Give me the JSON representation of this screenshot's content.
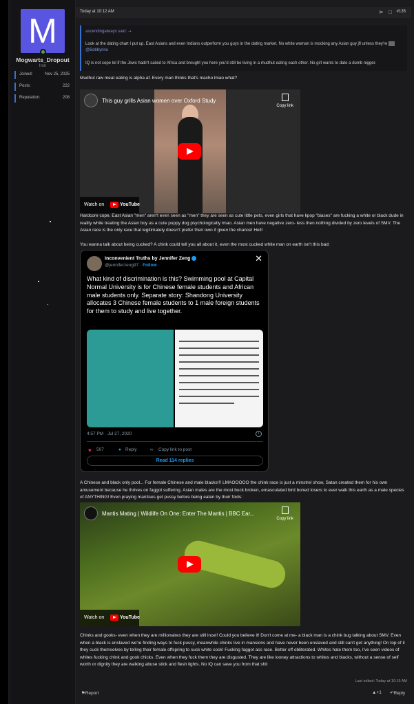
{
  "user": {
    "avatar_letter": "M",
    "avatar_color": "#5a55e0",
    "online_color": "#5aa33c",
    "username": "Mogwarts_Dropout",
    "title": "Iron",
    "stats": [
      {
        "label": "Joined:",
        "value": "Nov 25, 2025"
      },
      {
        "label": "Posts:",
        "value": "222"
      },
      {
        "label": "Reputation:",
        "value": "208"
      }
    ]
  },
  "post": {
    "date": "Today at 10:12 AM",
    "share_icon": "share-icon",
    "bookmark_icon": "bookmark-icon",
    "number": "#135",
    "quote": {
      "author": "ascendingalways said:",
      "arrow_icon": "go-to-quote-icon",
      "line1": "Look at the dating chart I put up. East Asians and even Indians outperform you guys in the dating market. No white woman is mocking any Asian guy jfl unless they're",
      "mention": "@Bobbyrino",
      "line2": "IQ is not cope lol if the Jews hadn't sailed to Africa and brought you here you'd still be living in a mudhut eating each other. No girl wants to date a dumb nigger."
    },
    "para1": "Mudhut raw meat eating is alpha af. Every man thinks that's macho lmao what?",
    "video1": {
      "title": "This guy grills Asian women over Oxford Study",
      "copy_label": "Copy link",
      "watch_on": "Watch on",
      "youtube": "YouTube"
    },
    "para2": "Hardcore cope. East Asian \"men\" aren't even seen as \"men\" they are seen as cute little pets, even girls that have kpop \"biases\" are fucking a white or black dude in reality while treating the Asian boy as a cute puppy dog psychologically lmao. Asian men have negative zero- less then nothing divided by zero levels of SMV. The Asian race is the only race that legitimately doesn't prefer their own if given the chance! Hell!",
    "para3": "You wanna talk about being cucked? A chink could tell you all about it, even the most cucked white man on earth isn't this bad:",
    "tweet": {
      "name": "Inconvenient Truths by Jennifer Zeng",
      "handle": "@jenniferzeng97",
      "follow": "Follow",
      "text": "What kind of discrimination is this? Swimming pool at Capital Normal University is for Chinese female students and African male students only. Separate story: Shandong University allocates 3 Chinese female students to 1 male foreign students for them to study and live together.",
      "time": "4:57 PM · Jul 27, 2020",
      "likes": "507",
      "reply": "Reply",
      "copy": "Copy link to post",
      "read": "Read 114 replies"
    },
    "para4": "A Chinese and black only pool... For female Chinese and male blacks!!! LMAOOOOO the chink race is just a minstrel show, Satan created them for his own amusement because he thrives on faggot suffering. Asian males are the most buck broken, emasculated bird boned losers to ever walk this earth as a male species of ANYTHING! Even praying mantises get pussy before being eaten by their foids:",
    "video2": {
      "title": "Mantis Mating | Wildlife On One: Enter The Mantis | BBC Ear...",
      "copy_label": "Copy link",
      "watch_on": "Watch on",
      "youtube": "YouTube"
    },
    "para5": "Chinks and gooks- even when they are millionaires they are still incel! Could you believe it! Don't come at me- a black man is a chink bug talking about SMV. Even when a black is enslaved we're finding ways to fuck pussy, meanwhile chinks live in mansions and have never been enslaved and still can't get anything! On top of it they cuck themselves by telling their female offspring to suck white cock! Fucking faggot ass race. Better off obliterated. Whites hate them too, I've seen videos of whites fucking chink and gook chicks. Even when they fuck them they are disgusted. They are like looney attractions to whites and blacks, without a sense of self worth or dignity they are walking abuse stick and flesh lights. No IQ can save you from that shit",
    "edited": "Last edited: Today at 10:15 AM",
    "report": "Report",
    "reaction": "+1",
    "reply": "Reply"
  }
}
